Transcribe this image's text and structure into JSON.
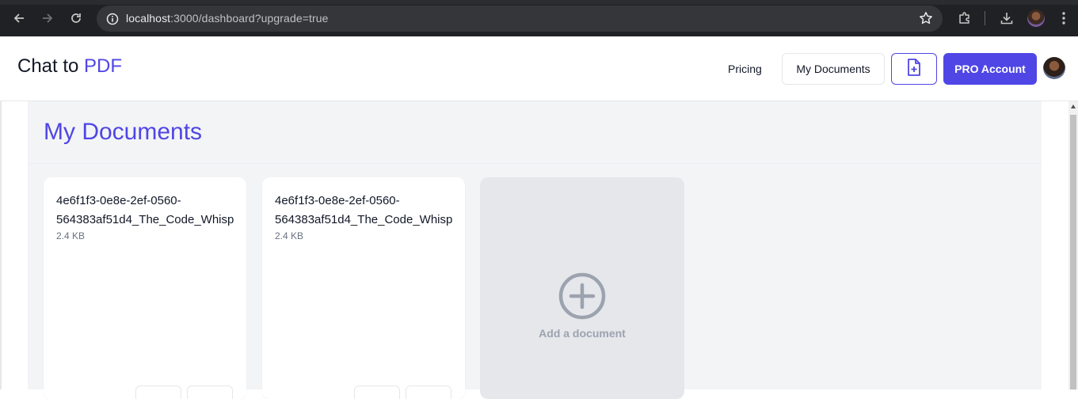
{
  "browser": {
    "url_host": "localhost",
    "url_path": ":3000/dashboard?upgrade=true"
  },
  "header": {
    "logo_prefix": "Chat to ",
    "logo_accent": "PDF",
    "pricing_label": "Pricing",
    "my_documents_label": "My Documents",
    "pro_label": "PRO Account"
  },
  "main": {
    "title": "My Documents",
    "documents": [
      {
        "name_line1": "4e6f1f3-0e8e-2ef-0560-",
        "name_line2": "564383af51d4_The_Code_Whisp",
        "size": "2.4 KB"
      },
      {
        "name_line1": "4e6f1f3-0e8e-2ef-0560-",
        "name_line2": "564383af51d4_The_Code_Whisp",
        "size": "2.4 KB"
      }
    ],
    "add_label": "Add a document"
  },
  "colors": {
    "accent": "#4f46e5",
    "panel_bg": "#f3f4f6",
    "add_card_bg": "#e5e7eb",
    "muted_text": "#9ca3af"
  },
  "icons": [
    "back-arrow-icon",
    "forward-arrow-icon",
    "reload-icon",
    "site-info-icon",
    "star-icon",
    "extensions-icon",
    "download-icon",
    "menu-dots-icon",
    "file-plus-icon",
    "plus-circle-icon"
  ]
}
